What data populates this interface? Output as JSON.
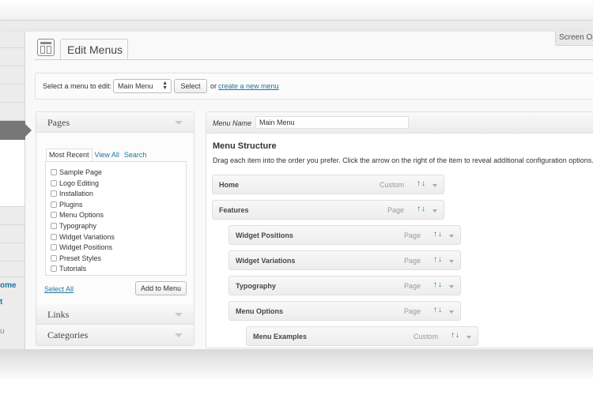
{
  "header": {
    "page_title": "Edit Menus",
    "screen_options": "Screen Opt"
  },
  "admin_menu": {
    "labels": [
      "ome",
      "t",
      "u"
    ]
  },
  "manage": {
    "label": "Select a menu to edit:",
    "selected_menu": "Main Menu",
    "select_button": "Select",
    "or_text": "or",
    "create_link": "create a new menu",
    "period": "."
  },
  "sidebar": {
    "sections": [
      "Pages",
      "Links",
      "Categories"
    ],
    "tabs": [
      "Most Recent",
      "View All",
      "Search"
    ],
    "pages": [
      "Sample Page",
      "Logo Editing",
      "Installation",
      "Plugins",
      "Menu Options",
      "Typography",
      "Widget Variations",
      "Widget Positions",
      "Preset Styles",
      "Tutorials"
    ],
    "select_all": "Select All",
    "add_to_menu": "Add to Menu"
  },
  "editor": {
    "menu_name_label": "Menu Name",
    "menu_name_value": "Main Menu",
    "structure_title": "Menu Structure",
    "structure_help": "Drag each item into the order you prefer. Click the arrow on the right of the item to reveal additional configuration options.",
    "move_arrows": "↑↓",
    "items": [
      {
        "title": "Home",
        "type": "Custom",
        "depth": 0
      },
      {
        "title": "Features",
        "type": "Page",
        "depth": 0
      },
      {
        "title": "Widget Positions",
        "type": "Page",
        "depth": 1
      },
      {
        "title": "Widget Variations",
        "type": "Page",
        "depth": 1
      },
      {
        "title": "Typography",
        "type": "Page",
        "depth": 1
      },
      {
        "title": "Menu Options",
        "type": "Page",
        "depth": 1
      },
      {
        "title": "Menu Examples",
        "type": "Custom",
        "depth": 2
      }
    ]
  },
  "icons": {
    "page_icon": "menus-icon",
    "select_arrows": "up-down-arrows-icon",
    "accordion_caret": "caret-down-icon"
  },
  "colors": {
    "link": "#21759b",
    "admin_current": "#777777"
  }
}
